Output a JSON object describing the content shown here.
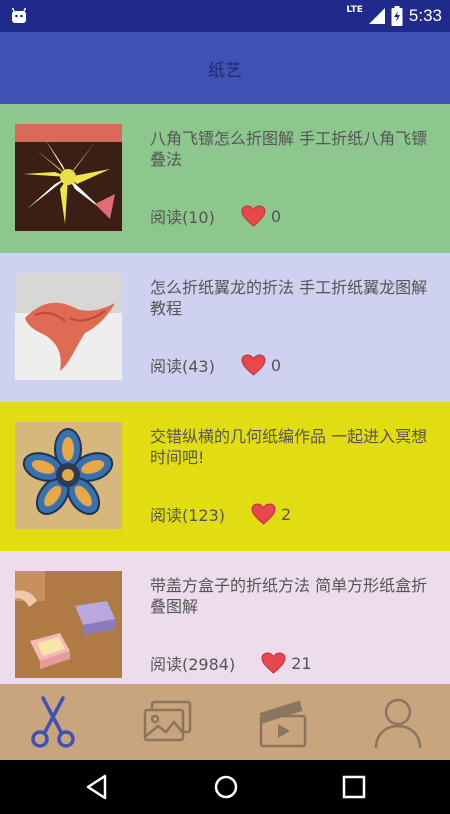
{
  "status_bar": {
    "network": "LTE",
    "time": "5:33"
  },
  "app_bar": {
    "title": "纸艺"
  },
  "items": [
    {
      "title": "八角飞镖怎么折图解 手工折纸八角飞镖叠法",
      "reads": "阅读(10)",
      "likes": "0",
      "bg": "#8dc78e"
    },
    {
      "title": "怎么折纸翼龙的折法 手工折纸翼龙图解教程",
      "reads": "阅读(43)",
      "likes": "0",
      "bg": "#cfd1f0"
    },
    {
      "title": "交错纵横的几何纸编作品 一起进入冥想时间吧!",
      "reads": "阅读(123)",
      "likes": "2",
      "bg": "#e2dd12"
    },
    {
      "title": "带盖方盒子的折纸方法 简单方形纸盒折叠图解",
      "reads": "阅读(2984)",
      "likes": "21",
      "bg": "#ecdcec"
    }
  ],
  "tabs": [
    {
      "icon": "scissors-icon",
      "active": true
    },
    {
      "icon": "gallery-icon",
      "active": false
    },
    {
      "icon": "video-icon",
      "active": false
    },
    {
      "icon": "profile-icon",
      "active": false
    }
  ],
  "colors": {
    "status_bar": "#1f2a8a",
    "app_bar": "#3f51b5",
    "tab_bar": "#c9a57e",
    "tab_active": "#3f51b5",
    "tab_inactive": "#8a7560",
    "heart": "#e8474e"
  }
}
